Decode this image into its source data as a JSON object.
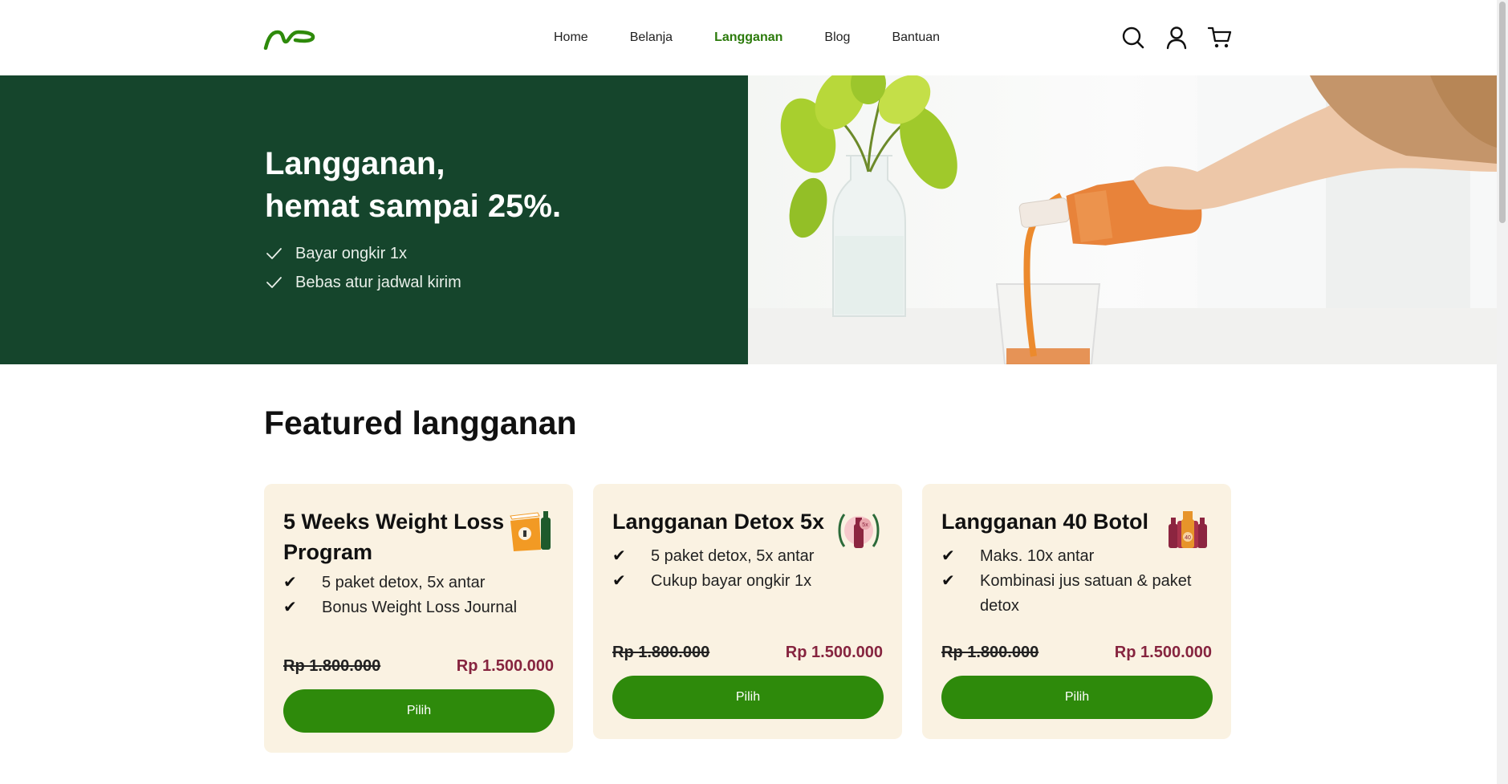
{
  "header": {
    "logo_alt": "np",
    "nav": [
      "Home",
      "Belanja",
      "Langganan",
      "Blog",
      "Bantuan"
    ],
    "active_nav": "Langganan",
    "icons": [
      "search-icon",
      "user-icon",
      "cart-icon"
    ]
  },
  "hero": {
    "title_line1": "Langganan,",
    "title_line2": "hemat sampai 25%.",
    "benefits": [
      "Bayar ongkir 1x",
      "Bebas atur jadwal kirim"
    ]
  },
  "section": {
    "title": "Featured langganan"
  },
  "cards": [
    {
      "title": "5 Weeks Weight Loss Program",
      "icon": "5-weeks-package-icon",
      "features": [
        "5 paket detox, 5x antar",
        "Bonus Weight Loss Journal"
      ],
      "old_price": "Rp 1.800.000",
      "new_price": "Rp 1.500.000",
      "button": "Pilih"
    },
    {
      "title": "Langganan Detox 5x",
      "icon": "detox-5x-bottle-icon",
      "features": [
        "5 paket detox, 5x antar",
        "Cukup bayar ongkir 1x"
      ],
      "old_price": "Rp 1.800.000",
      "new_price": "Rp 1.500.000",
      "button": "Pilih"
    },
    {
      "title": "Langganan 40 Botol",
      "icon": "40-bottles-icon",
      "features": [
        "Maks. 10x antar",
        "Kombinasi jus satuan & paket detox"
      ],
      "old_price": "Rp 1.800.000",
      "new_price": "Rp 1.500.000",
      "button": "Pilih"
    }
  ],
  "colors": {
    "brand_green": "#2e8a0b",
    "hero_green": "#15452c",
    "price_red": "#86243f",
    "card_bg": "#faf2e2"
  }
}
